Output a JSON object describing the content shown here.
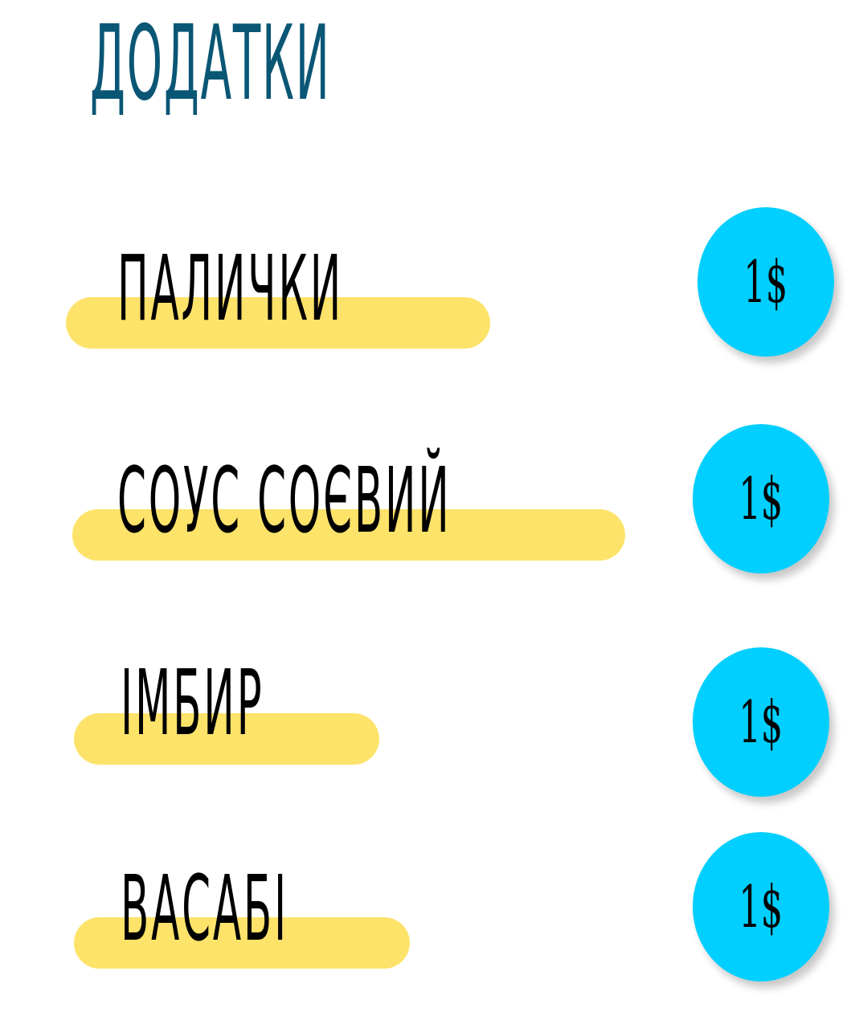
{
  "title": "ДОДАТКИ",
  "colors": {
    "title": "#0a5675",
    "highlight": "#fde36a",
    "badge": "#00cfff",
    "text": "#000000"
  },
  "items": [
    {
      "name": "ПАЛИЧКИ",
      "price": "1$"
    },
    {
      "name": "СОУС СОЄВИЙ",
      "price": "1$"
    },
    {
      "name": "ІМБИР",
      "price": "1$"
    },
    {
      "name": "ВАСАБІ",
      "price": "1$"
    }
  ]
}
